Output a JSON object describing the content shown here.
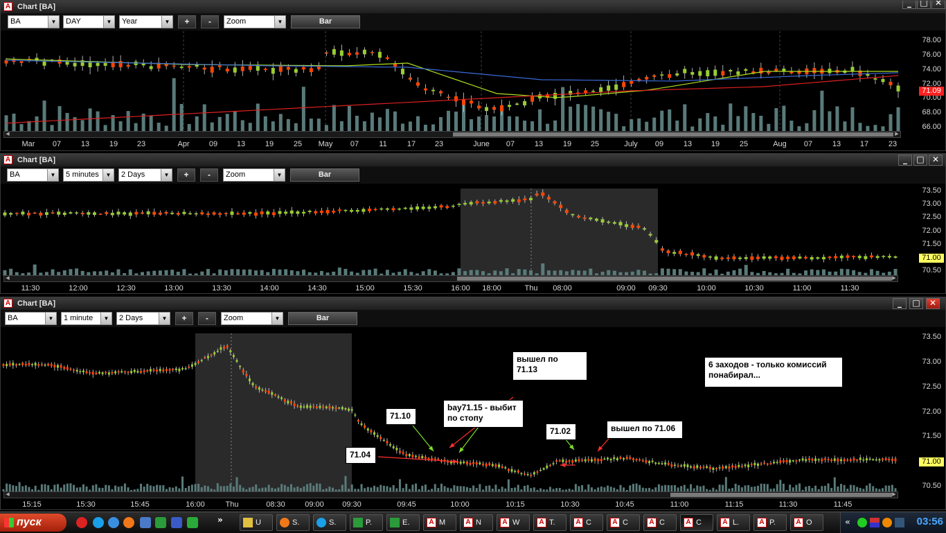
{
  "symbol": "BA",
  "colors": {
    "up": "#9acd32",
    "down": "#ff4500",
    "volume": "#5a7a7a",
    "ma_green": "#b0e020",
    "ma_blue": "#3a6ad8",
    "ma_red": "#e02020",
    "grid": "#444444"
  },
  "windows": [
    {
      "title": "Chart [BA]",
      "toolbar": {
        "symbol": "BA",
        "interval": "DAY",
        "range": "Year",
        "zoom": "Zoom",
        "plus": "+",
        "minus": "-",
        "bar": "Bar"
      },
      "y_labels": [
        "78.00",
        "76.00",
        "74.00",
        "72.00",
        "70.00",
        "68.00",
        "66.00"
      ],
      "price_tag": "71.09",
      "x_labels": [
        "Mar",
        "07",
        "13",
        "19",
        "23",
        "Apr",
        "09",
        "13",
        "19",
        "25",
        "May",
        "07",
        "11",
        "17",
        "23",
        "June",
        "07",
        "13",
        "19",
        "25",
        "July",
        "09",
        "13",
        "19",
        "25",
        "Aug",
        "07",
        "13",
        "17",
        "23"
      ]
    },
    {
      "title": "Chart [BA]",
      "toolbar": {
        "symbol": "BA",
        "interval": "5 minutes",
        "range": "2 Days",
        "zoom": "Zoom",
        "plus": "+",
        "minus": "-",
        "bar": "Bar"
      },
      "y_labels": [
        "73.50",
        "73.00",
        "72.50",
        "72.00",
        "71.50",
        "71.00",
        "70.50"
      ],
      "price_tag": "71.00",
      "x_labels": [
        "11:30",
        "12:00",
        "12:30",
        "13:00",
        "13:30",
        "14:00",
        "14:30",
        "15:00",
        "15:30",
        "16:00",
        "18:00",
        "Thu",
        "08:00",
        "09:00",
        "09:30",
        "10:00",
        "10:30",
        "11:00",
        "11:30"
      ]
    },
    {
      "title": "Chart [BA]",
      "toolbar": {
        "symbol": "BA",
        "interval": "1 minute",
        "range": "2 Days",
        "zoom": "Zoom",
        "plus": "+",
        "minus": "-",
        "bar": "Bar"
      },
      "y_labels": [
        "73.50",
        "73.00",
        "72.50",
        "72.00",
        "71.50",
        "71.00",
        "70.50"
      ],
      "price_tag": "71.00",
      "x_labels": [
        "15:15",
        "15:30",
        "15:45",
        "16:00",
        "Thu",
        "08:30",
        "09:00",
        "09:30",
        "09:45",
        "10:00",
        "10:15",
        "10:30",
        "10:45",
        "11:00",
        "11:15",
        "11:30",
        "11:45"
      ],
      "notes": {
        "exit1": "вышел по\n71.13",
        "entry": "bay71.15 - выбит\nпо стопу",
        "p1": "71.10",
        "p2": "71.04",
        "p3": "71.02",
        "exit2": "вышел по 71.06",
        "summary": "6 заходов - только комиссий\nпонабирал..."
      }
    }
  ],
  "taskbar": {
    "start": "пуск",
    "tasks": [
      {
        "label": "U",
        "icon": "folder-icon"
      },
      {
        "label": "S.",
        "icon": "firefox-icon"
      },
      {
        "label": "S.",
        "icon": "skype-icon"
      },
      {
        "label": "P.",
        "icon": "excel-icon"
      },
      {
        "label": "E.",
        "icon": "excel-icon"
      },
      {
        "label": "M",
        "icon": "chart-app-icon"
      },
      {
        "label": "N",
        "icon": "chart-app-icon"
      },
      {
        "label": "W",
        "icon": "chart-app-icon"
      },
      {
        "label": "T.",
        "icon": "chart-app-icon"
      },
      {
        "label": "C",
        "icon": "chart-app-icon"
      },
      {
        "label": "C",
        "icon": "chart-app-icon"
      },
      {
        "label": "C",
        "icon": "chart-app-icon"
      },
      {
        "label": "C",
        "icon": "chart-app-icon"
      },
      {
        "label": "L.",
        "icon": "chart-app-icon"
      },
      {
        "label": "P.",
        "icon": "chart-app-icon"
      },
      {
        "label": "O",
        "icon": "chart-app-icon"
      }
    ],
    "clock": "03:56"
  }
}
